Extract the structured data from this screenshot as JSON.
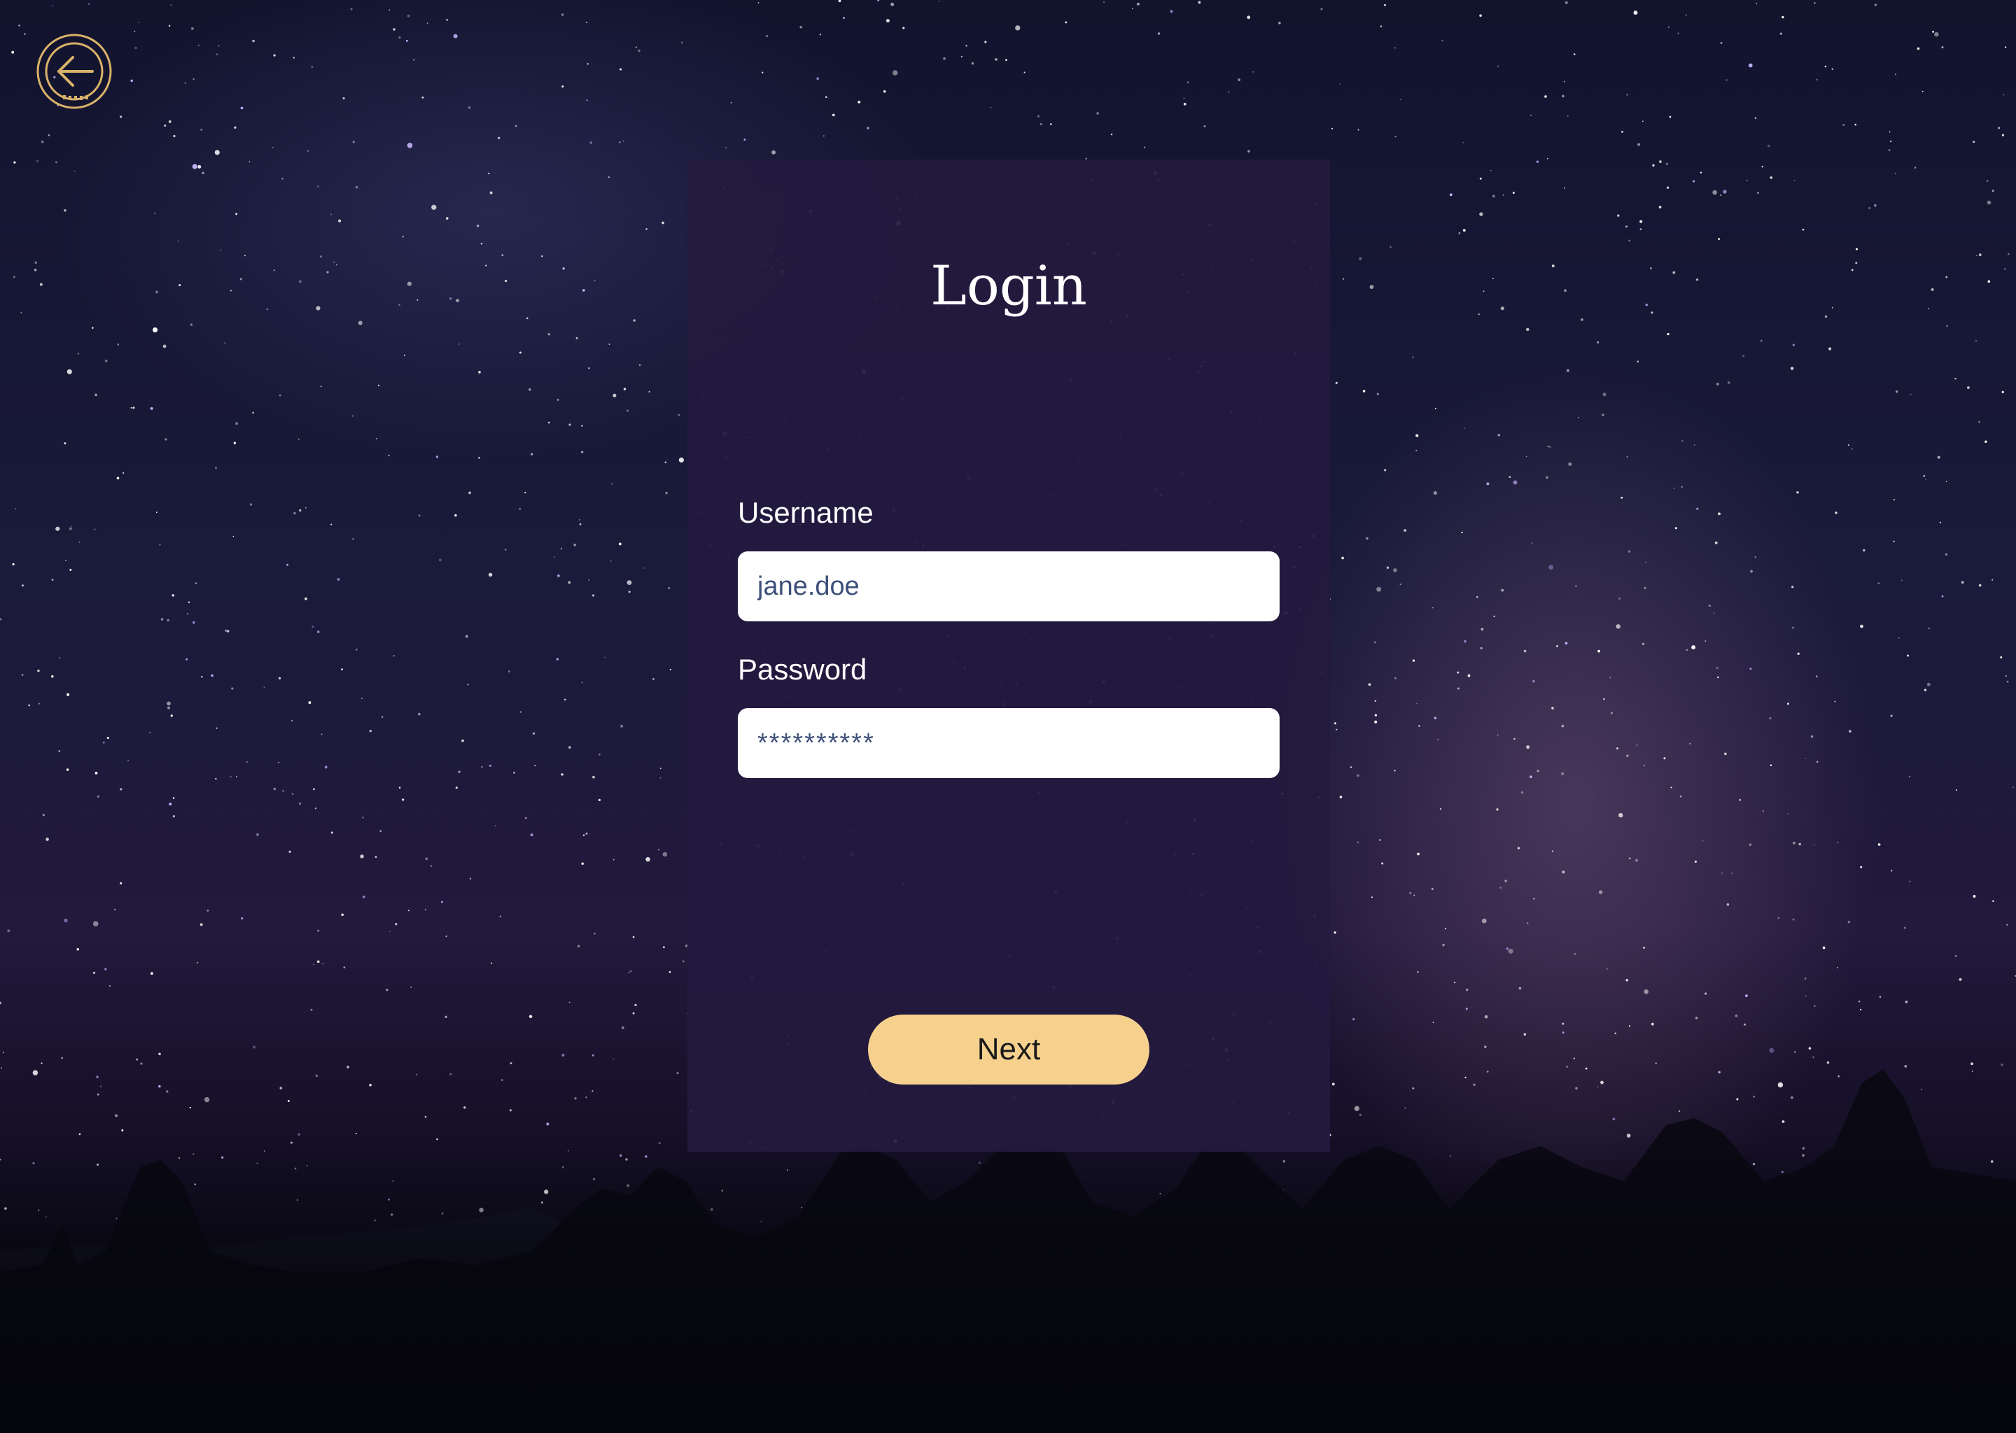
{
  "login": {
    "title": "Login",
    "username_label": "Username",
    "username_value": "jane.doe",
    "password_label": "Password",
    "password_value": "**********",
    "next_label": "Next"
  },
  "nav": {
    "back_icon": "back-arrow-circle-icon"
  },
  "colors": {
    "card_background": "#231a3e",
    "accent_gold": "#f6d18e",
    "icon_gold": "#d9b26a",
    "input_text": "#3d4f7a",
    "label_text": "#ffffff"
  }
}
